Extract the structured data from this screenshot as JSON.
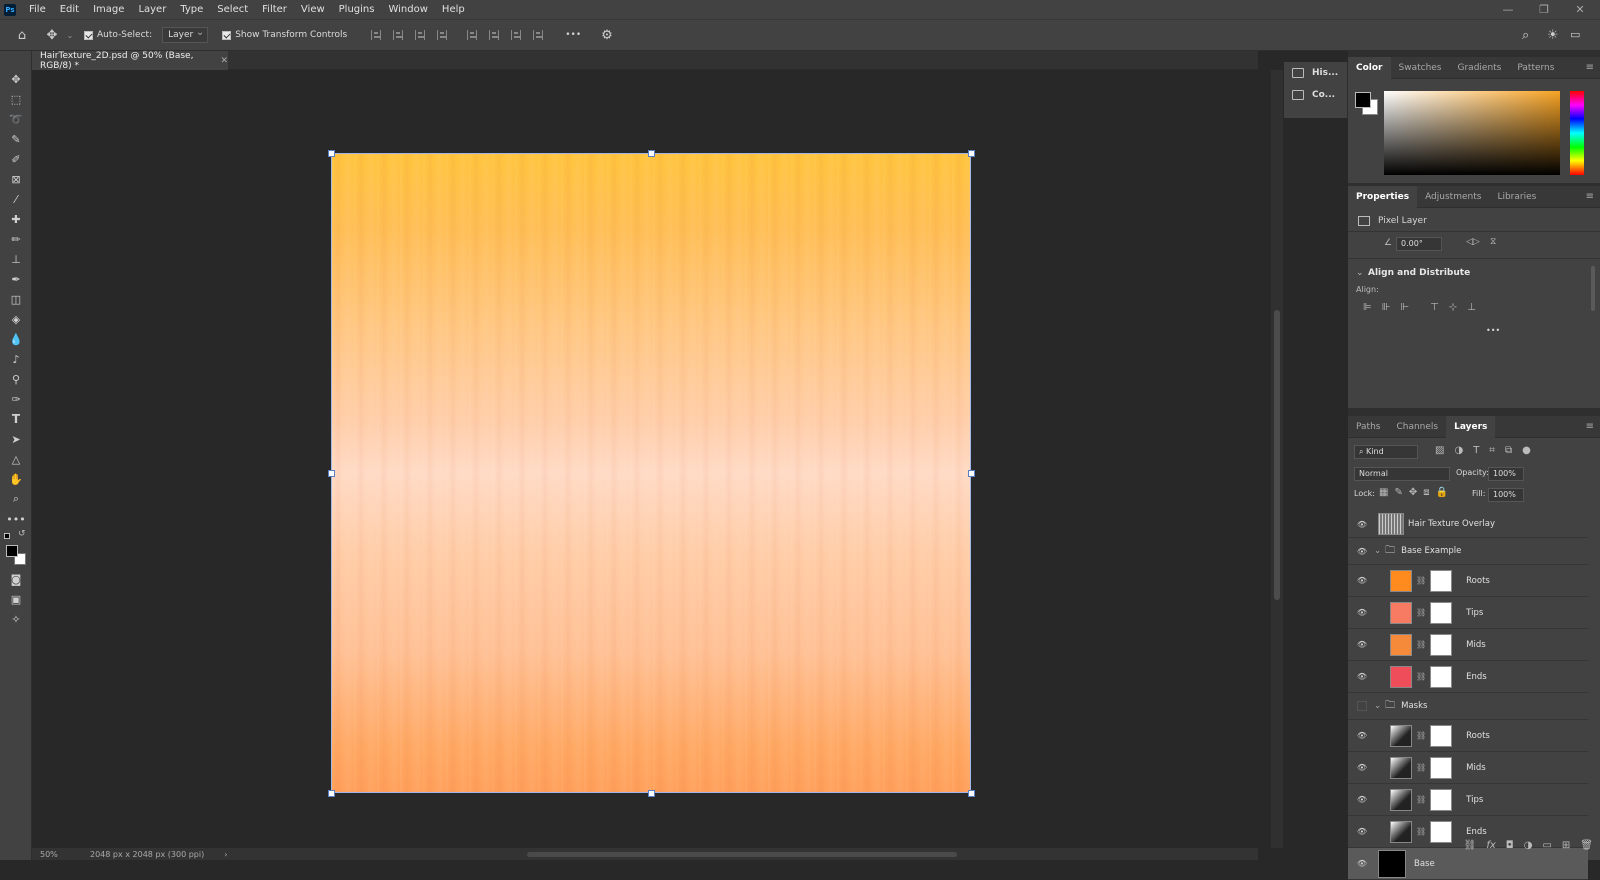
{
  "menubar": {
    "logo": "Ps",
    "items": [
      "File",
      "Edit",
      "Image",
      "Layer",
      "Type",
      "Select",
      "Filter",
      "View",
      "Plugins",
      "Window",
      "Help"
    ],
    "window_controls": {
      "minimize": "—",
      "restore": "❐",
      "close": "✕"
    }
  },
  "options": {
    "auto_select_label": "Auto-Select:",
    "auto_select_value": "Layer",
    "show_transform_label": "Show Transform Controls",
    "more": "•••"
  },
  "document": {
    "tab_title": "HairTexture_2D.psd @ 50% (Base, RGB/8) *",
    "close": "✕"
  },
  "status": {
    "zoom": "50%",
    "dimensions": "2048 px x 2048 px (300 ppi)",
    "arrow": "›"
  },
  "minipanel": {
    "history": "His...",
    "comments": "Co..."
  },
  "color_panel": {
    "tabs": [
      "Color",
      "Swatches",
      "Gradients",
      "Patterns"
    ],
    "active": "Color"
  },
  "properties_panel": {
    "tabs": [
      "Properties",
      "Adjustments",
      "Libraries"
    ],
    "active": "Properties",
    "layer_type": "Pixel Layer",
    "angle": "0.00°",
    "section": "Align and Distribute",
    "align_label": "Align:",
    "more": "•••"
  },
  "layers_panel": {
    "tabs": [
      "Paths",
      "Channels",
      "Layers"
    ],
    "active": "Layers",
    "filter_kind": "Kind",
    "blend_mode": "Normal",
    "opacity_label": "Opacity:",
    "opacity": "100%",
    "lock_label": "Lock:",
    "fill_label": "Fill:",
    "fill": "100%",
    "layers": [
      {
        "name": "Hair Texture Overlay",
        "type": "layer",
        "visible": true
      },
      {
        "name": "Base Example",
        "type": "group",
        "visible": true
      },
      {
        "name": "Roots",
        "type": "masked",
        "visible": true,
        "color": "#ff8a1e"
      },
      {
        "name": "Tips",
        "type": "masked",
        "visible": true,
        "color": "#f77a62"
      },
      {
        "name": "Mids",
        "type": "masked",
        "visible": true,
        "color": "#f58a3a"
      },
      {
        "name": "Ends",
        "type": "masked",
        "visible": true,
        "color": "#f04d5a"
      },
      {
        "name": "Masks",
        "type": "group",
        "visible": false
      },
      {
        "name": "Roots",
        "type": "mask-layer",
        "visible": true
      },
      {
        "name": "Mids",
        "type": "mask-layer",
        "visible": true
      },
      {
        "name": "Tips",
        "type": "mask-layer",
        "visible": true
      },
      {
        "name": "Ends",
        "type": "mask-layer",
        "visible": true
      },
      {
        "name": "Base",
        "type": "base",
        "visible": true,
        "selected": true
      }
    ]
  }
}
